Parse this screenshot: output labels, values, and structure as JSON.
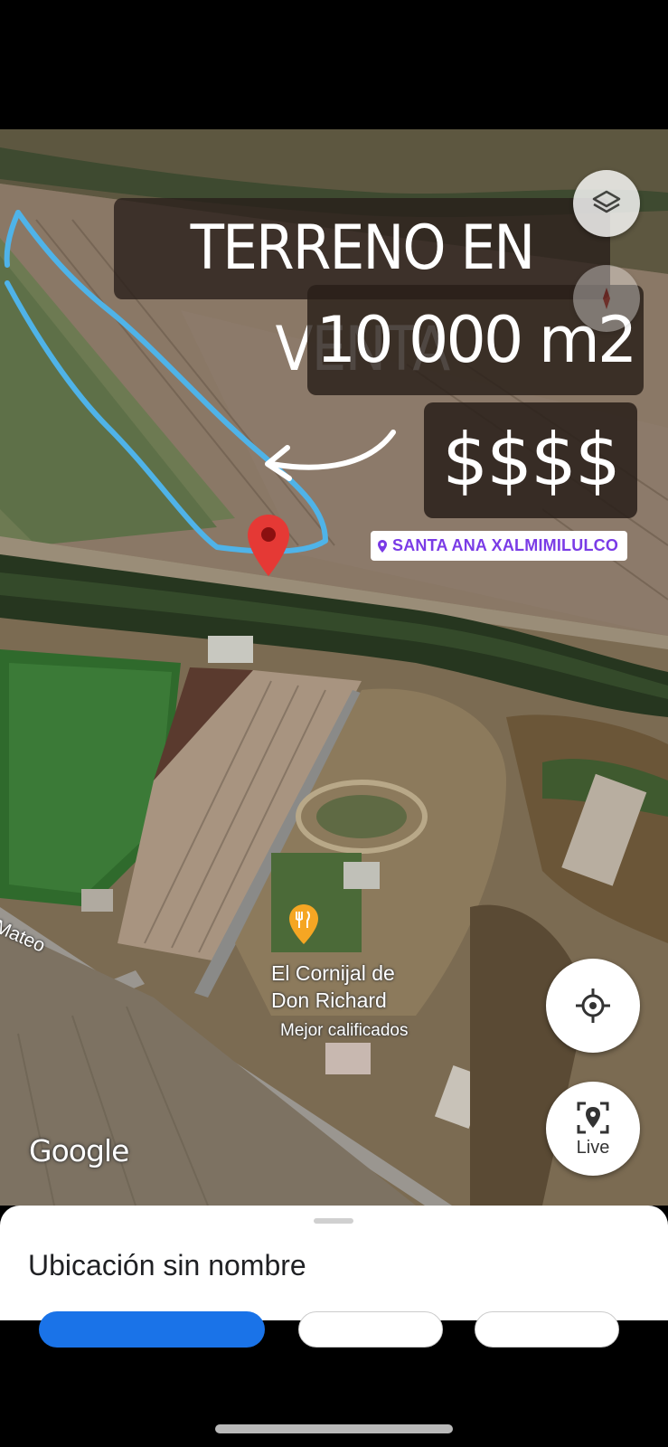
{
  "overlay": {
    "title": "TERRENO EN VENTA",
    "area": "10 000 m2",
    "price": "$$$$",
    "location_tag": "SANTA ANA XALMIMILULCO"
  },
  "map": {
    "poi_name_line1": "El Cornijal de",
    "poi_name_line2": "Don Richard",
    "poi_subtitle": "Mejor calificados",
    "street_label": "Mateo",
    "attribution": "Google",
    "poi_icon": "restaurant-icon"
  },
  "controls": {
    "layers_icon": "layers-icon",
    "compass_icon": "compass-icon",
    "locate_icon": "my-location-icon",
    "live_label": "Live",
    "live_icon": "live-view-icon"
  },
  "sheet": {
    "title": "Ubicación sin nombre"
  },
  "colors": {
    "outline": "#4fb3e8",
    "pin": "#e53935",
    "tag_text": "#7a3be6",
    "primary_button": "#1a73e8"
  }
}
